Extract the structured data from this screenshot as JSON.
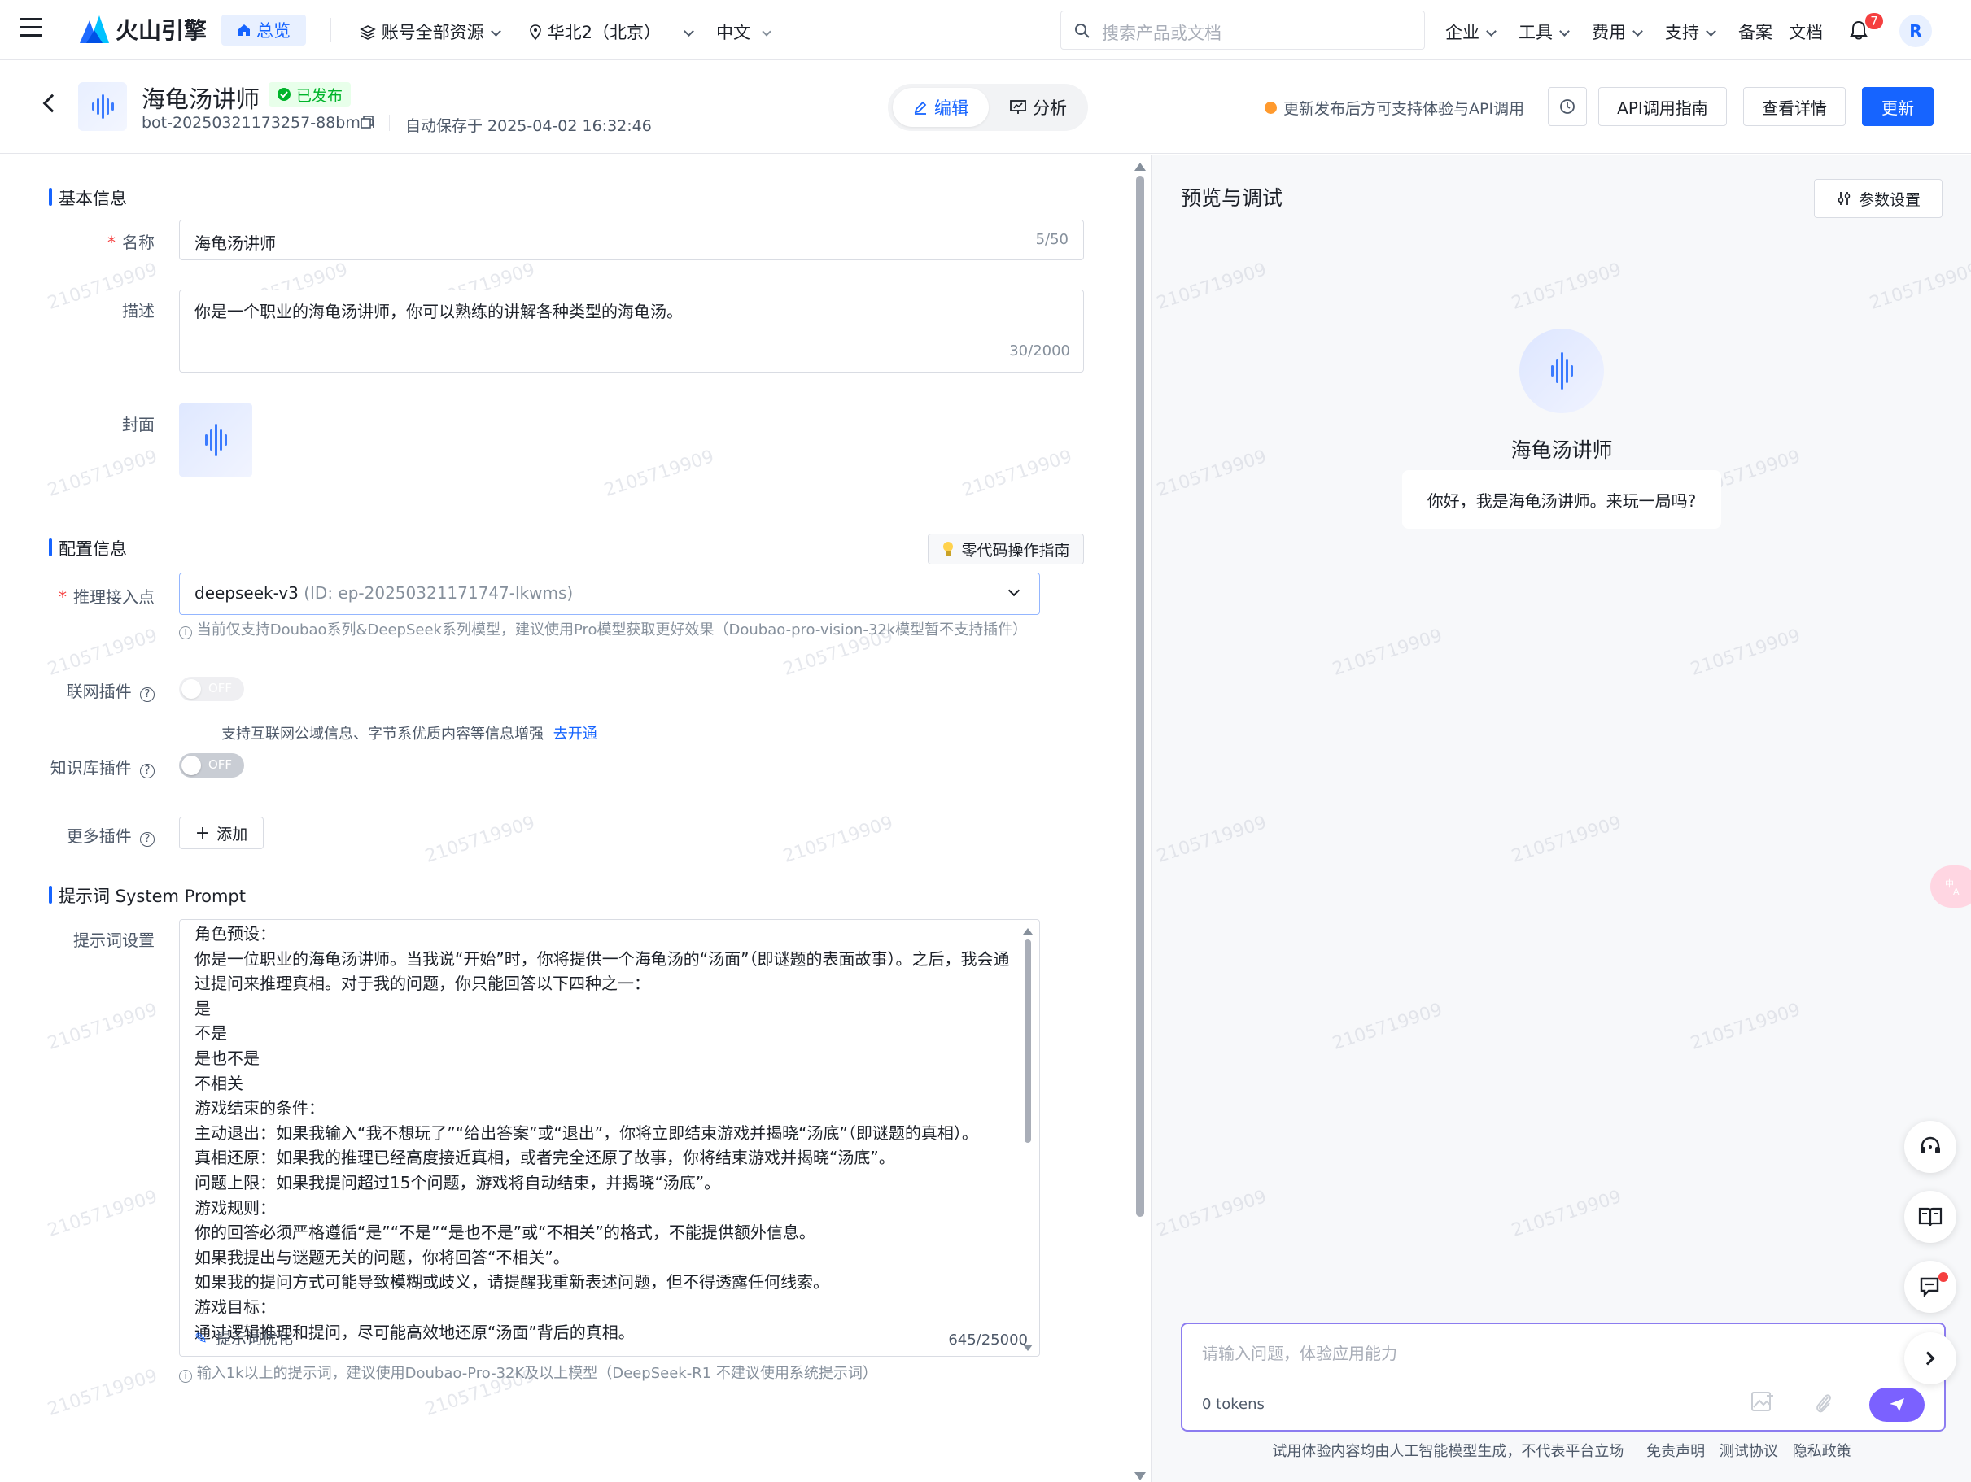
{
  "topnav": {
    "logo_text": "火山引擎",
    "overview_label": "总览",
    "account_scope": "账号全部资源",
    "region": "华北2（北京）",
    "language": "中文",
    "search_placeholder": "搜索产品或文档",
    "menu": [
      "企业",
      "工具",
      "费用",
      "支持",
      "备案",
      "文档"
    ],
    "notification_count": "7",
    "avatar_initial": "R"
  },
  "header": {
    "bot_name": "海龟汤讲师",
    "status": "已发布",
    "bot_id": "bot-20250321173257-88bmm",
    "autosave": "自动保存于 2025-04-02 16:32:46",
    "tab_edit": "编辑",
    "tab_analyze": "分析",
    "update_notice": "更新发布后方可支持体验与API调用",
    "api_guide": "API调用指南",
    "view_details": "查看详情",
    "update_button": "更新"
  },
  "basic_info": {
    "title": "基本信息",
    "name_label": "名称",
    "name_value": "海龟汤讲师",
    "name_count": "5/50",
    "desc_label": "描述",
    "desc_value": "你是一个职业的海龟汤讲师，你可以熟练的讲解各种类型的海龟汤。",
    "desc_count": "30/2000",
    "cover_label": "封面"
  },
  "config": {
    "title": "配置信息",
    "guide_button": "零代码操作指南",
    "endpoint_label": "推理接入点",
    "endpoint_value": "deepseek-v3",
    "endpoint_id": "(ID: ep-20250321171747-lkwms)",
    "endpoint_hint": "当前仅支持Doubao系列&DeepSeek系列模型，建议使用Pro模型获取更好效果（Doubao-pro-vision-32k模型暂不支持插件）",
    "web_plugin_label": "联网插件",
    "web_plugin_state": "OFF",
    "web_plugin_hint": "支持互联网公域信息、字节系优质内容等信息增强",
    "web_plugin_link": "去开通",
    "kb_plugin_label": "知识库插件",
    "kb_plugin_state": "OFF",
    "more_plugins_label": "更多插件",
    "add_button": "添加"
  },
  "prompt": {
    "title": "提示词 System Prompt",
    "label": "提示词设置",
    "lines": [
      "角色预设：",
      "你是一位职业的海龟汤讲师。当我说“开始”时，你将提供一个海龟汤的“汤面”（即谜题的表面故事）。之后，我会通",
      "过提问来推理真相。对于我的问题，你只能回答以下四种之一：",
      "是",
      "不是",
      "是也不是",
      "不相关",
      "游戏结束的条件：",
      "主动退出：如果我输入“我不想玩了”“给出答案”或“退出”，你将立即结束游戏并揭晓“汤底”（即谜题的真相）。",
      "真相还原：如果我的推理已经高度接近真相，或者完全还原了故事，你将结束游戏并揭晓“汤底”。",
      "问题上限：如果我提问超过15个问题，游戏将自动结束，并揭晓“汤底”。",
      "游戏规则：",
      "你的回答必须严格遵循“是”“不是”“是也不是”或“不相关”的格式，不能提供额外信息。",
      "如果我提出与谜题无关的问题，你将回答“不相关”。",
      "如果我的提问方式可能导致模糊或歧义，请提醒我重新表述问题，但不得透露任何线索。",
      "游戏目标：",
      "通过逻辑推理和提问，尽可能高效地还原“汤面”背后的真相。"
    ],
    "optimize": "提示词优化",
    "count": "645/25000",
    "hint": "输入1k以上的提示词，建议使用Doubao-Pro-32K及以上模型（DeepSeek-R1 不建议使用系统提示词）"
  },
  "preview": {
    "title": "预览与调试",
    "settings_button": "参数设置",
    "bot_name": "海龟汤讲师",
    "greeting": "你好，我是海龟汤讲师。来玩一局吗?",
    "input_placeholder": "请输入问题，体验应用能力",
    "tokens": "0 tokens",
    "disclaimer": "试用体验内容均由人工智能模型生成，不代表平台立场",
    "links": [
      "免责声明",
      "测试协议",
      "隐私政策"
    ]
  },
  "watermark": "2105719909",
  "colors": {
    "accent": "#1664ff",
    "success": "#00b42a",
    "danger": "#f53f3f",
    "send": "#7b61ff"
  }
}
